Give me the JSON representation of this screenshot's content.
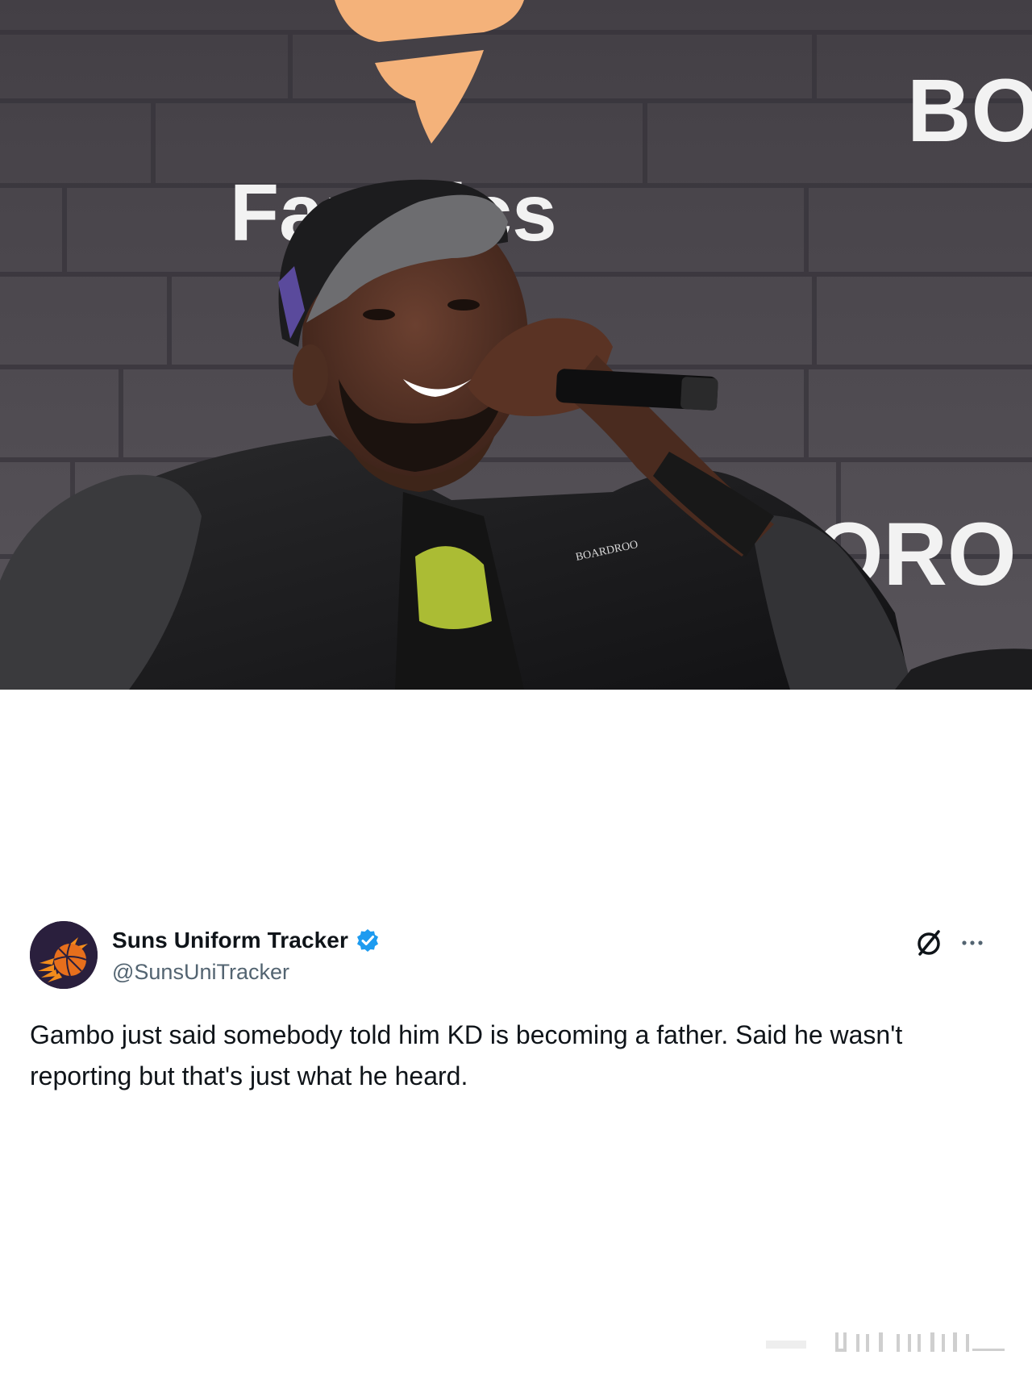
{
  "photo": {
    "alt": "",
    "backdrop_text": {
      "brand": "Fanatics",
      "side_top": "BO",
      "side_bottom": "ORO"
    },
    "shirt_text": "BOARDROO",
    "colors": {
      "wall": "#4a464b",
      "logo_orange": "#f4b27a"
    }
  },
  "tweet": {
    "author": {
      "display_name": "Suns Uniform Tracker",
      "handle": "@SunsUniTracker",
      "verified": true,
      "avatar_icon": "suns-logo-icon"
    },
    "text": "Gambo just said somebody told him KD is becoming a father. Said he wasn't reporting but that's just what he heard.",
    "actions": {
      "grok_icon": "grok-icon",
      "more_icon": "more-dots-icon"
    },
    "colors": {
      "verified_blue": "#1d9bf0",
      "text": "#0f1419",
      "muted": "#536471"
    }
  }
}
